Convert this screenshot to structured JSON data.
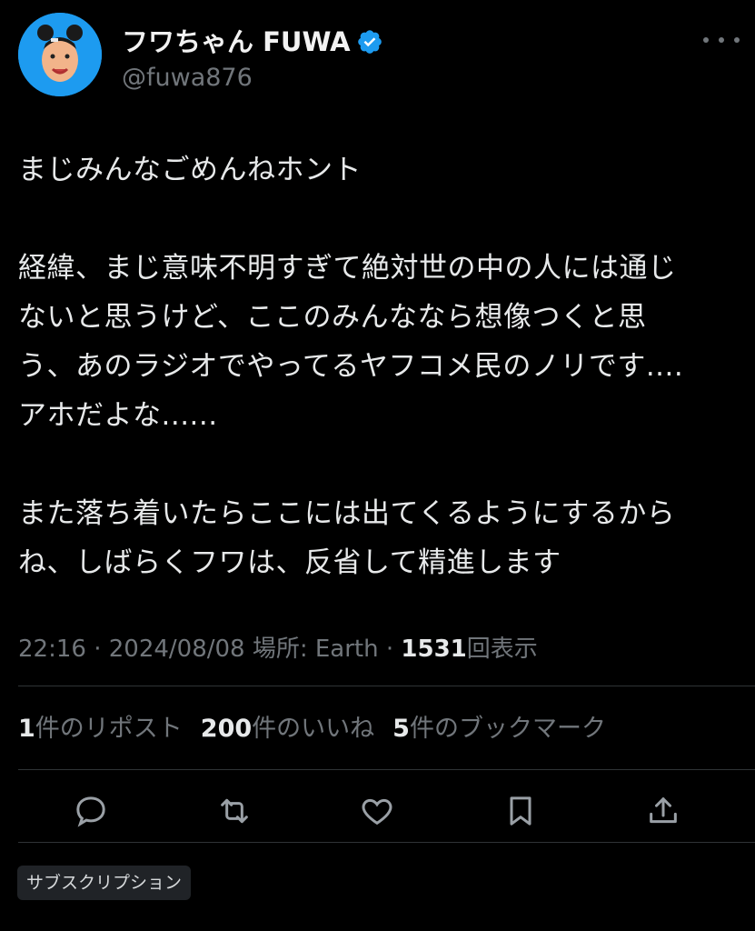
{
  "author": {
    "display_name": "フワちゃん FUWA",
    "handle": "@fuwa876",
    "verified": true,
    "avatar_bg": "#1d9bf0"
  },
  "tweet": {
    "lines": [
      "まじみんなごめんねホント",
      "",
      "経緯、まじ意味不明すぎて絶対世の中の人には通じ",
      "ないと思うけど、ここのみんななら想像つくと思",
      "う、あのラジオでやってるヤフコメ民のノリです....",
      "アホだよな......",
      "",
      "また落ち着いたらここには出てくるようにするから",
      "ね、しばらくフワは、反省して精進します"
    ]
  },
  "meta": {
    "time": "22:16",
    "date": "2024/08/08",
    "location_label": "場所: Earth",
    "views_count": "1531",
    "views_label": "回表示",
    "separator": "·"
  },
  "stats": {
    "reposts_count": "1",
    "reposts_label": "件のリポスト",
    "likes_count": "200",
    "likes_label": "件のいいね",
    "bookmarks_count": "5",
    "bookmarks_label": "件のブックマーク"
  },
  "actions": [
    "reply-icon",
    "repost-icon",
    "like-icon",
    "bookmark-icon",
    "share-icon"
  ],
  "subscription_label": "サブスクリプション",
  "colors": {
    "background": "#000000",
    "text": "#e7e9ea",
    "secondary": "#71767b",
    "accent": "#1d9bf0",
    "divider": "#2f3336"
  }
}
